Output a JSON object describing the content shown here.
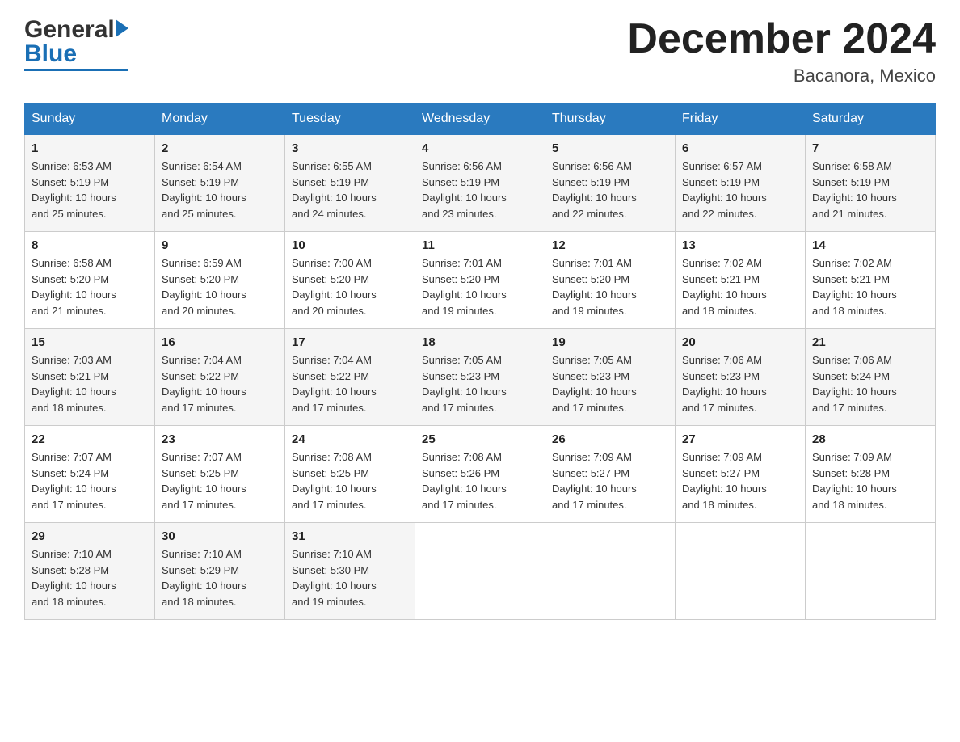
{
  "header": {
    "logo_general": "General",
    "logo_blue": "Blue",
    "month_title": "December 2024",
    "location": "Bacanora, Mexico"
  },
  "days_of_week": [
    "Sunday",
    "Monday",
    "Tuesday",
    "Wednesday",
    "Thursday",
    "Friday",
    "Saturday"
  ],
  "weeks": [
    [
      {
        "day": "1",
        "sunrise": "6:53 AM",
        "sunset": "5:19 PM",
        "daylight": "10 hours and 25 minutes."
      },
      {
        "day": "2",
        "sunrise": "6:54 AM",
        "sunset": "5:19 PM",
        "daylight": "10 hours and 25 minutes."
      },
      {
        "day": "3",
        "sunrise": "6:55 AM",
        "sunset": "5:19 PM",
        "daylight": "10 hours and 24 minutes."
      },
      {
        "day": "4",
        "sunrise": "6:56 AM",
        "sunset": "5:19 PM",
        "daylight": "10 hours and 23 minutes."
      },
      {
        "day": "5",
        "sunrise": "6:56 AM",
        "sunset": "5:19 PM",
        "daylight": "10 hours and 22 minutes."
      },
      {
        "day": "6",
        "sunrise": "6:57 AM",
        "sunset": "5:19 PM",
        "daylight": "10 hours and 22 minutes."
      },
      {
        "day": "7",
        "sunrise": "6:58 AM",
        "sunset": "5:19 PM",
        "daylight": "10 hours and 21 minutes."
      }
    ],
    [
      {
        "day": "8",
        "sunrise": "6:58 AM",
        "sunset": "5:20 PM",
        "daylight": "10 hours and 21 minutes."
      },
      {
        "day": "9",
        "sunrise": "6:59 AM",
        "sunset": "5:20 PM",
        "daylight": "10 hours and 20 minutes."
      },
      {
        "day": "10",
        "sunrise": "7:00 AM",
        "sunset": "5:20 PM",
        "daylight": "10 hours and 20 minutes."
      },
      {
        "day": "11",
        "sunrise": "7:01 AM",
        "sunset": "5:20 PM",
        "daylight": "10 hours and 19 minutes."
      },
      {
        "day": "12",
        "sunrise": "7:01 AM",
        "sunset": "5:20 PM",
        "daylight": "10 hours and 19 minutes."
      },
      {
        "day": "13",
        "sunrise": "7:02 AM",
        "sunset": "5:21 PM",
        "daylight": "10 hours and 18 minutes."
      },
      {
        "day": "14",
        "sunrise": "7:02 AM",
        "sunset": "5:21 PM",
        "daylight": "10 hours and 18 minutes."
      }
    ],
    [
      {
        "day": "15",
        "sunrise": "7:03 AM",
        "sunset": "5:21 PM",
        "daylight": "10 hours and 18 minutes."
      },
      {
        "day": "16",
        "sunrise": "7:04 AM",
        "sunset": "5:22 PM",
        "daylight": "10 hours and 17 minutes."
      },
      {
        "day": "17",
        "sunrise": "7:04 AM",
        "sunset": "5:22 PM",
        "daylight": "10 hours and 17 minutes."
      },
      {
        "day": "18",
        "sunrise": "7:05 AM",
        "sunset": "5:23 PM",
        "daylight": "10 hours and 17 minutes."
      },
      {
        "day": "19",
        "sunrise": "7:05 AM",
        "sunset": "5:23 PM",
        "daylight": "10 hours and 17 minutes."
      },
      {
        "day": "20",
        "sunrise": "7:06 AM",
        "sunset": "5:23 PM",
        "daylight": "10 hours and 17 minutes."
      },
      {
        "day": "21",
        "sunrise": "7:06 AM",
        "sunset": "5:24 PM",
        "daylight": "10 hours and 17 minutes."
      }
    ],
    [
      {
        "day": "22",
        "sunrise": "7:07 AM",
        "sunset": "5:24 PM",
        "daylight": "10 hours and 17 minutes."
      },
      {
        "day": "23",
        "sunrise": "7:07 AM",
        "sunset": "5:25 PM",
        "daylight": "10 hours and 17 minutes."
      },
      {
        "day": "24",
        "sunrise": "7:08 AM",
        "sunset": "5:25 PM",
        "daylight": "10 hours and 17 minutes."
      },
      {
        "day": "25",
        "sunrise": "7:08 AM",
        "sunset": "5:26 PM",
        "daylight": "10 hours and 17 minutes."
      },
      {
        "day": "26",
        "sunrise": "7:09 AM",
        "sunset": "5:27 PM",
        "daylight": "10 hours and 17 minutes."
      },
      {
        "day": "27",
        "sunrise": "7:09 AM",
        "sunset": "5:27 PM",
        "daylight": "10 hours and 18 minutes."
      },
      {
        "day": "28",
        "sunrise": "7:09 AM",
        "sunset": "5:28 PM",
        "daylight": "10 hours and 18 minutes."
      }
    ],
    [
      {
        "day": "29",
        "sunrise": "7:10 AM",
        "sunset": "5:28 PM",
        "daylight": "10 hours and 18 minutes."
      },
      {
        "day": "30",
        "sunrise": "7:10 AM",
        "sunset": "5:29 PM",
        "daylight": "10 hours and 18 minutes."
      },
      {
        "day": "31",
        "sunrise": "7:10 AM",
        "sunset": "5:30 PM",
        "daylight": "10 hours and 19 minutes."
      },
      null,
      null,
      null,
      null
    ]
  ],
  "labels": {
    "sunrise": "Sunrise:",
    "sunset": "Sunset:",
    "daylight": "Daylight:"
  }
}
